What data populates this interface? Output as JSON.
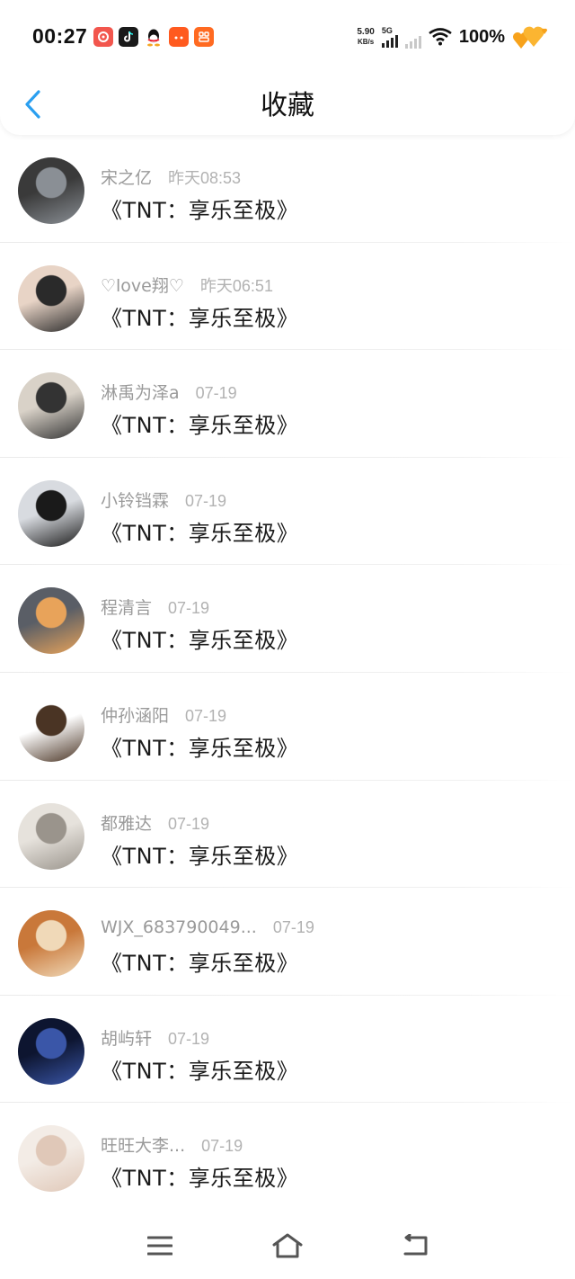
{
  "status_bar": {
    "time": "00:27",
    "net_speed": "5.90",
    "net_unit": "KB/s",
    "network": "5G",
    "battery": "100%"
  },
  "header": {
    "title": "收藏",
    "back_icon": "chevron-left-icon"
  },
  "items": [
    {
      "name": "宋之亿",
      "date": "昨天08:53",
      "content": "《TNT：享乐至极》",
      "avatar_colors": [
        "#3a3a3a",
        "#8a8f95"
      ]
    },
    {
      "name": "♡love翔♡",
      "date": "昨天06:51",
      "content": "《TNT：享乐至极》",
      "avatar_colors": [
        "#e8d4c6",
        "#2a2a2a"
      ]
    },
    {
      "name": "淋禹为泽a",
      "date": "07-19",
      "content": "《TNT：享乐至极》",
      "avatar_colors": [
        "#d9d2c8",
        "#333333"
      ]
    },
    {
      "name": "小铃铛霖",
      "date": "07-19",
      "content": "《TNT：享乐至极》",
      "avatar_colors": [
        "#d8dbe0",
        "#1a1a1a"
      ]
    },
    {
      "name": "程清言",
      "date": "07-19",
      "content": "《TNT：享乐至极》",
      "avatar_colors": [
        "#5a5e66",
        "#e8a35a"
      ]
    },
    {
      "name": "仲孙涵阳",
      "date": "07-19",
      "content": "《TNT：享乐至极》",
      "avatar_colors": [
        "#ffffff",
        "#4a3424"
      ]
    },
    {
      "name": "都雅达",
      "date": "07-19",
      "content": "《TNT：享乐至极》",
      "avatar_colors": [
        "#e6e2dc",
        "#9a948c"
      ]
    },
    {
      "name": "WJX_683790049...",
      "date": "07-19",
      "content": "《TNT：享乐至极》",
      "avatar_colors": [
        "#c9783a",
        "#f0d9b8"
      ]
    },
    {
      "name": "胡屿轩",
      "date": "07-19",
      "content": "《TNT：享乐至极》",
      "avatar_colors": [
        "#0d1530",
        "#3a56a8"
      ]
    },
    {
      "name": "旺旺大李...",
      "date": "07-19",
      "content": "《TNT：享乐至极》",
      "avatar_colors": [
        "#f3ece6",
        "#e0c8b8"
      ]
    }
  ],
  "navbar": {
    "menu_icon": "menu-icon",
    "home_icon": "home-icon",
    "back_icon": "back-icon"
  },
  "colors": {
    "accent": "#2a9ff0",
    "text_primary": "#1c1c1c",
    "text_secondary": "#9a9a9a"
  }
}
